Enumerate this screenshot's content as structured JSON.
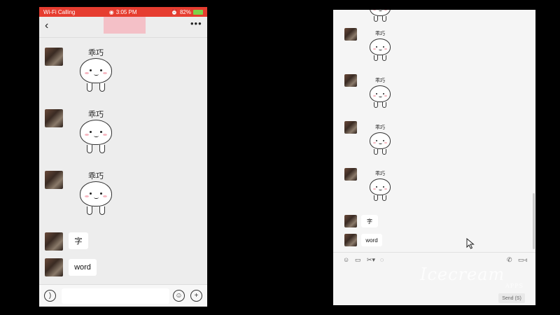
{
  "phone": {
    "status": {
      "carrier": "Wi-Fi Calling",
      "time": "3:05 PM",
      "battery": "82%"
    },
    "nav": {
      "back_icon": "chevron-left-icon",
      "more_icon": "ellipsis-icon"
    },
    "messages": [
      {
        "type": "sticker",
        "caption": "乖巧"
      },
      {
        "type": "sticker",
        "caption": "乖巧"
      },
      {
        "type": "sticker",
        "caption": "乖巧"
      },
      {
        "type": "text",
        "text": "字"
      },
      {
        "type": "text",
        "text": "word"
      }
    ]
  },
  "desktop": {
    "messages": [
      {
        "type": "sticker",
        "caption": "乖巧"
      },
      {
        "type": "sticker",
        "caption": "乖巧"
      },
      {
        "type": "sticker",
        "caption": "乖巧"
      },
      {
        "type": "sticker",
        "caption": "乖巧"
      },
      {
        "type": "text",
        "text": "字"
      },
      {
        "type": "text",
        "text": "word"
      }
    ],
    "send_label": "Send (S)"
  },
  "watermark": {
    "main": "Icecream",
    "sub": "APPS"
  }
}
